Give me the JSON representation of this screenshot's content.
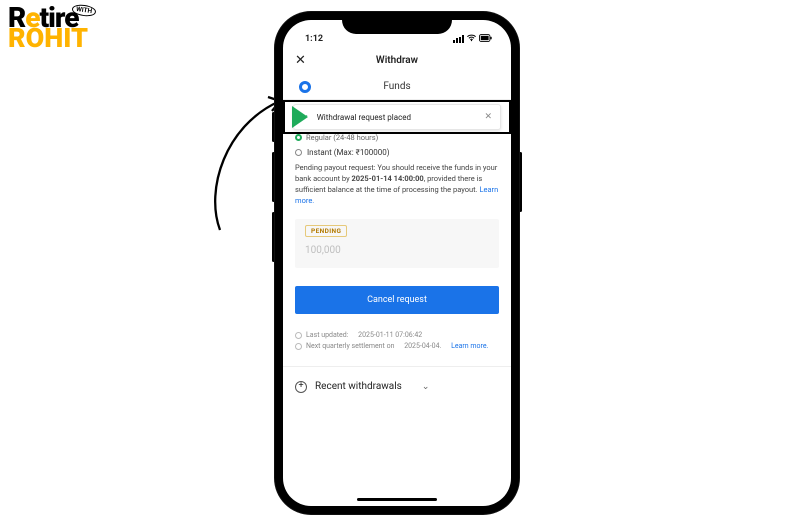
{
  "logo": {
    "retire": "Retire",
    "with": "WITH",
    "rohit": "ROHIT"
  },
  "status_bar": {
    "time": "1:12"
  },
  "header": {
    "title": "Withdraw",
    "broker_label": "Funds"
  },
  "toast": {
    "message": "Withdrawal request placed"
  },
  "options": {
    "regular_label": "Regular (24-48 hours)",
    "instant_label": "Instant (Max: ₹100000)"
  },
  "pending_notice": {
    "prefix": "Pending payout request: You should receive the funds in your bank account by ",
    "eta": "2025-01-14 14:00:00",
    "suffix": ", provided there is sufficient balance at the time of processing the payout. ",
    "learn_more": "Learn more."
  },
  "pending_card": {
    "badge": "PENDING",
    "amount": "100,000"
  },
  "actions": {
    "cancel_label": "Cancel request"
  },
  "meta": {
    "last_updated_label": "Last updated:",
    "last_updated_value": "2025-01-11 07:06:42",
    "next_settlement_label": "Next quarterly settlement on",
    "next_settlement_value": "2025-04-04.",
    "learn_more": "Learn more."
  },
  "recent": {
    "label": "Recent withdrawals"
  }
}
